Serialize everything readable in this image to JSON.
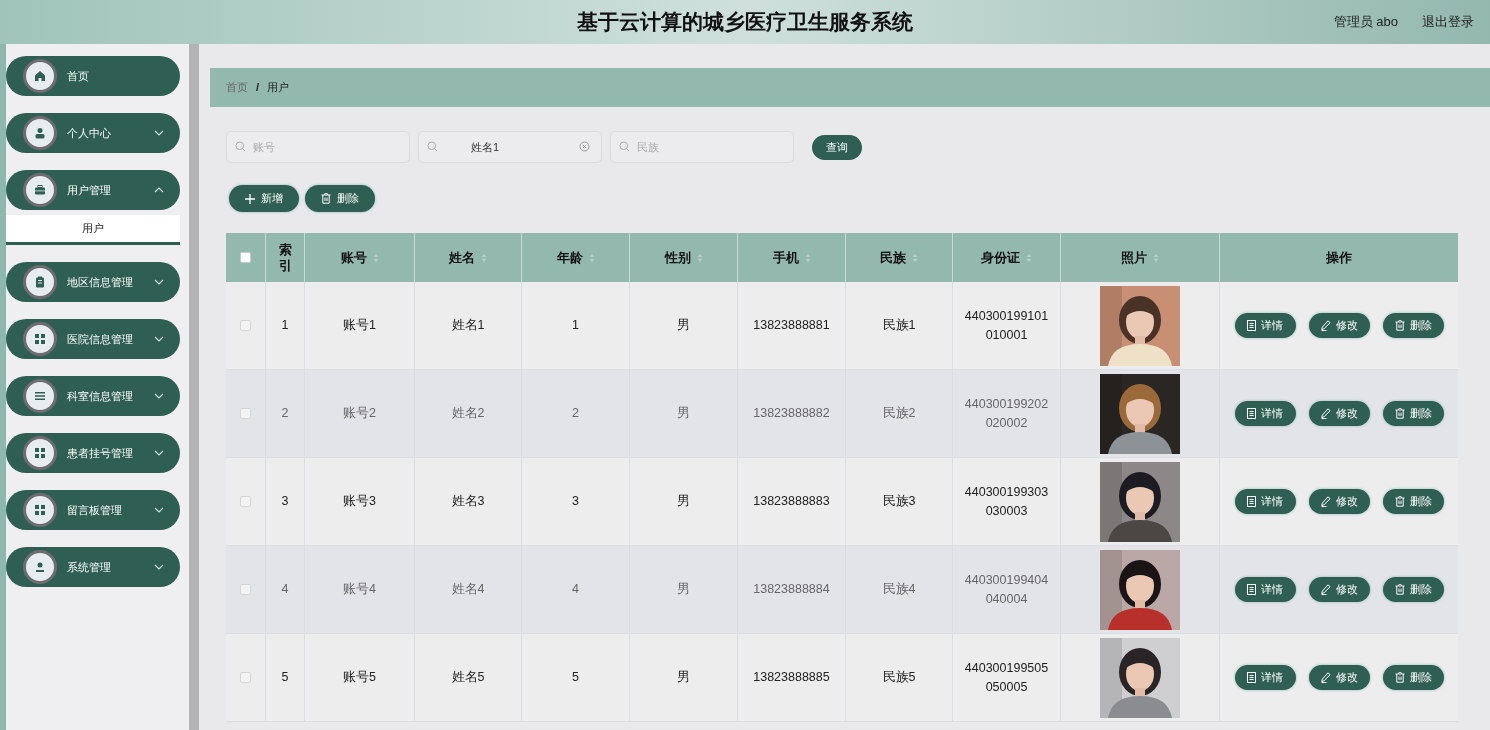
{
  "header": {
    "title": "基于云计算的城乡医疗卫生服务系统",
    "user": "管理员 abo",
    "logout": "退出登录"
  },
  "sidebar": {
    "items": [
      {
        "label": "首页",
        "expandable": false
      },
      {
        "label": "个人中心",
        "expandable": true,
        "expanded": false
      },
      {
        "label": "用户管理",
        "expandable": true,
        "expanded": true,
        "children": [
          {
            "label": "用户",
            "selected": true
          }
        ]
      },
      {
        "label": "地区信息管理",
        "expandable": true,
        "expanded": false
      },
      {
        "label": "医院信息管理",
        "expandable": true,
        "expanded": false
      },
      {
        "label": "科室信息管理",
        "expandable": true,
        "expanded": false
      },
      {
        "label": "患者挂号管理",
        "expandable": true,
        "expanded": false
      },
      {
        "label": "留言板管理",
        "expandable": true,
        "expanded": false
      },
      {
        "label": "系统管理",
        "expandable": true,
        "expanded": false
      }
    ]
  },
  "breadcrumb": {
    "items": [
      "首页",
      "用户"
    ],
    "separator": "/"
  },
  "search": {
    "fields": [
      {
        "placeholder": "账号"
      },
      {
        "value": "姓名1"
      },
      {
        "placeholder": "民族"
      }
    ],
    "button": "查询"
  },
  "actions": [
    {
      "kind": "add",
      "label": "新增"
    },
    {
      "kind": "delete",
      "label": "删除"
    }
  ],
  "table": {
    "select_all": {
      "checked": false
    },
    "columns": [
      {
        "label": "索引",
        "sortable": false
      },
      {
        "label": "账号",
        "sortable": true
      },
      {
        "label": "姓名",
        "sortable": true
      },
      {
        "label": "年龄",
        "sortable": true
      },
      {
        "label": "性别",
        "sortable": true
      },
      {
        "label": "手机",
        "sortable": true
      },
      {
        "label": "民族",
        "sortable": true
      },
      {
        "label": "身份证",
        "sortable": true
      },
      {
        "label": "照片",
        "sortable": true
      },
      {
        "label": "操作",
        "sortable": false
      }
    ],
    "rows": [
      {
        "checked": false,
        "cells": [
          "1",
          "账号1",
          "姓名1",
          "1",
          "男",
          "13823888881",
          "民族1",
          "440300199101\n010001"
        ],
        "actions": [
          {
            "kind": "detail",
            "label": "详情"
          },
          {
            "kind": "edit",
            "label": "修改"
          },
          {
            "kind": "delete",
            "label": "删除"
          }
        ]
      },
      {
        "checked": false,
        "cells": [
          "2",
          "账号2",
          "姓名2",
          "2",
          "男",
          "13823888882",
          "民族2",
          "440300199202\n020002"
        ],
        "actions": [
          {
            "kind": "detail",
            "label": "详情"
          },
          {
            "kind": "edit",
            "label": "修改"
          },
          {
            "kind": "delete",
            "label": "删除"
          }
        ]
      },
      {
        "checked": false,
        "cells": [
          "3",
          "账号3",
          "姓名3",
          "3",
          "男",
          "13823888883",
          "民族3",
          "440300199303\n030003"
        ],
        "actions": [
          {
            "kind": "detail",
            "label": "详情"
          },
          {
            "kind": "edit",
            "label": "修改"
          },
          {
            "kind": "delete",
            "label": "删除"
          }
        ]
      },
      {
        "checked": false,
        "cells": [
          "4",
          "账号4",
          "姓名4",
          "4",
          "男",
          "13823888884",
          "民族4",
          "440300199404\n040004"
        ],
        "actions": [
          {
            "kind": "detail",
            "label": "详情"
          },
          {
            "kind": "edit",
            "label": "修改"
          },
          {
            "kind": "delete",
            "label": "删除"
          }
        ]
      },
      {
        "checked": false,
        "cells": [
          "5",
          "账号5",
          "姓名5",
          "5",
          "男",
          "13823888885",
          "民族5",
          "440300199505\n050005"
        ],
        "actions": [
          {
            "kind": "detail",
            "label": "详情"
          },
          {
            "kind": "edit",
            "label": "修改"
          },
          {
            "kind": "delete",
            "label": "删除"
          }
        ]
      }
    ]
  }
}
